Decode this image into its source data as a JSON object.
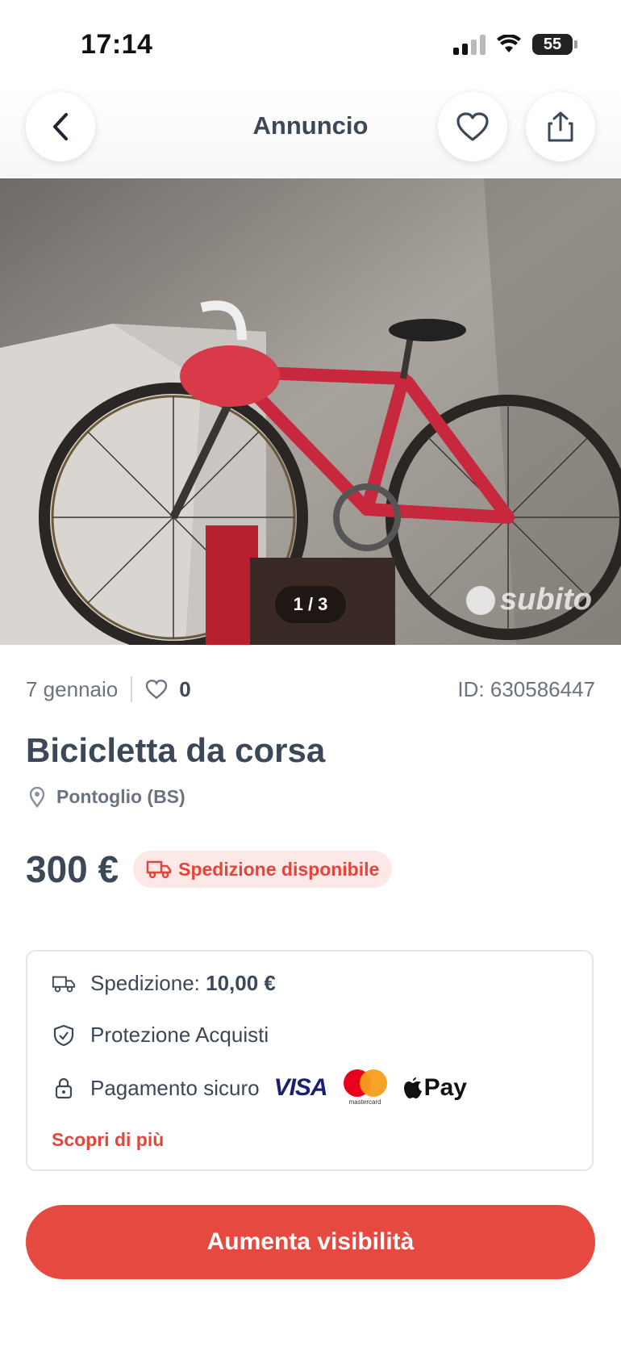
{
  "status_bar": {
    "time": "17:14",
    "battery": "55"
  },
  "header": {
    "title": "Annuncio"
  },
  "gallery": {
    "counter": "1 / 3",
    "watermark": "subito"
  },
  "meta": {
    "date": "7 gennaio",
    "likes": "0",
    "id": "ID: 630586447"
  },
  "listing": {
    "title": "Bicicletta da corsa",
    "location": "Pontoglio (BS)",
    "price": "300 €",
    "shipping_badge": "Spedizione disponibile"
  },
  "info": {
    "shipping_label": "Spedizione:",
    "shipping_value": "10,00 €",
    "protection": "Protezione Acquisti",
    "payment": "Pagamento sicuro",
    "visa": "VISA",
    "mastercard": "mastercard",
    "applepay": "Pay",
    "discover": "Scopri di più"
  },
  "cta": {
    "label": "Aumenta visibilità"
  },
  "colors": {
    "accent": "#e5493f",
    "text": "#3c4858",
    "muted": "#6b7280"
  }
}
